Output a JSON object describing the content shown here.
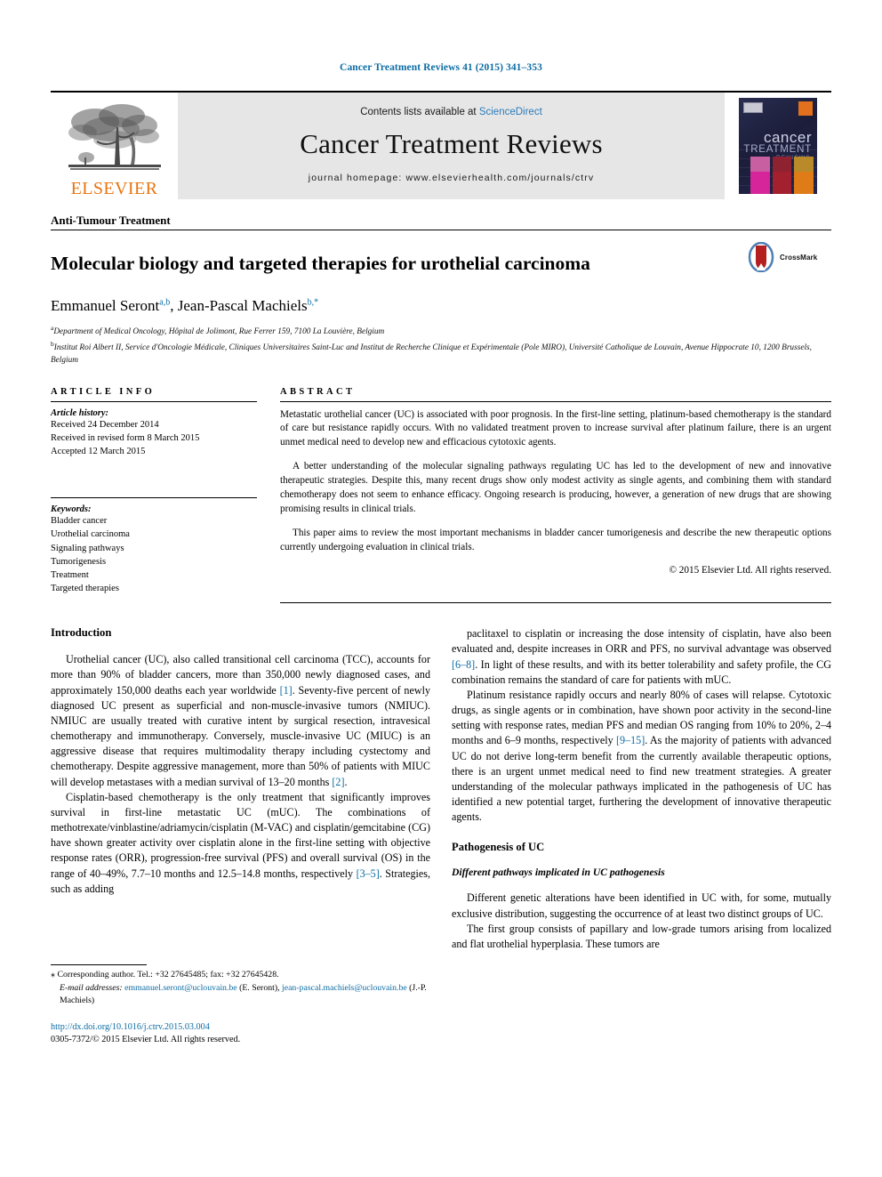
{
  "running_head": "Cancer Treatment Reviews 41 (2015) 341–353",
  "colors": {
    "link_blue": "#0c6ca3",
    "sciencedirect_blue": "#2b7bb9",
    "elsevier_orange": "#e87511",
    "banner_grey": "#e6e6e6",
    "cover_navy": "#23264a"
  },
  "banner": {
    "publisher_logo_text": "ELSEVIER",
    "contents_prefix": "Contents lists available at ",
    "contents_link": "ScienceDirect",
    "journal_name": "Cancer Treatment Reviews",
    "homepage": "journal homepage: www.elsevierhealth.com/journals/ctrv",
    "cover": {
      "line1": "cancer",
      "line2": "TREATMENT",
      "line3": "REVIEWS"
    }
  },
  "article": {
    "kicker": "Anti-Tumour Treatment",
    "title": "Molecular biology and targeted therapies for urothelial carcinoma",
    "crossmark_label": "CrossMark",
    "authors": [
      {
        "name": "Emmanuel Seront",
        "marks": "a,b"
      },
      {
        "name": "Jean-Pascal Machiels",
        "marks": "b,*"
      }
    ],
    "authors_separator": ", ",
    "affiliations": [
      {
        "mark": "a",
        "text": "Department of Medical Oncology, Hôpital de Jolimont, Rue Ferrer 159, 7100 La Louvière, Belgium"
      },
      {
        "mark": "b",
        "text": "Institut Roi Albert II, Service d'Oncologie Médicale, Cliniques Universitaires Saint-Luc and Institut de Recherche Clinique et Expérimentale (Pole MIRO), Université Catholique de Louvain, Avenue Hippocrate 10, 1200 Brussels, Belgium"
      }
    ]
  },
  "article_info": {
    "heading": "ARTICLE INFO",
    "history_label": "Article history:",
    "history": [
      "Received 24 December 2014",
      "Received in revised form 8 March 2015",
      "Accepted 12 March 2015"
    ],
    "keywords_label": "Keywords:",
    "keywords": [
      "Bladder cancer",
      "Urothelial carcinoma",
      "Signaling pathways",
      "Tumorigenesis",
      "Treatment",
      "Targeted therapies"
    ]
  },
  "abstract": {
    "heading": "ABSTRACT",
    "paragraphs": [
      "Metastatic urothelial cancer (UC) is associated with poor prognosis. In the first-line setting, platinum-based chemotherapy is the standard of care but resistance rapidly occurs. With no validated treatment proven to increase survival after platinum failure, there is an urgent unmet medical need to develop new and efficacious cytotoxic agents.",
      "A better understanding of the molecular signaling pathways regulating UC has led to the development of new and innovative therapeutic strategies. Despite this, many recent drugs show only modest activity as single agents, and combining them with standard chemotherapy does not seem to enhance efficacy. Ongoing research is producing, however, a generation of new drugs that are showing promising results in clinical trials.",
      "This paper aims to review the most important mechanisms in bladder cancer tumorigenesis and describe the new therapeutic options currently undergoing evaluation in clinical trials."
    ],
    "copyright": "© 2015 Elsevier Ltd. All rights reserved."
  },
  "body": {
    "left": {
      "heading": "Introduction",
      "paragraphs": [
        [
          {
            "t": "Urothelial cancer (UC), also called transitional cell carcinoma (TCC), accounts for more than 90% of bladder cancers, more than 350,000 newly diagnosed cases, and approximately 150,000 deaths each year worldwide "
          },
          {
            "t": "[1]",
            "ref": true
          },
          {
            "t": ". Seventy-five percent of newly diagnosed UC present as superficial and non-muscle-invasive tumors (NMIUC). NMIUC are usually treated with curative intent by surgical resection, intravesical chemotherapy and immunotherapy. Conversely, muscle-invasive UC (MIUC) is an aggressive disease that requires multimodality therapy including cystectomy and chemotherapy. Despite aggressive management, more than 50% of patients with MIUC will develop metastases with a median survival of 13–20 months "
          },
          {
            "t": "[2]",
            "ref": true
          },
          {
            "t": "."
          }
        ],
        [
          {
            "t": "Cisplatin-based chemotherapy is the only treatment that significantly improves survival in first-line metastatic UC (mUC). The combinations of methotrexate/vinblastine/adriamycin/cisplatin (M-VAC) and cisplatin/gemcitabine (CG) have shown greater activity over cisplatin alone in the first-line setting with objective response rates (ORR), progression-free survival (PFS) and overall survival (OS) in the range of 40–49%, 7.7–10 months and 12.5–14.8 months, respectively "
          },
          {
            "t": "[3–5]",
            "ref": true
          },
          {
            "t": ". Strategies, such as adding"
          }
        ]
      ]
    },
    "right": {
      "paragraphs": [
        [
          {
            "t": "paclitaxel to cisplatin or increasing the dose intensity of cisplatin, have also been evaluated and, despite increases in ORR and PFS, no survival advantage was observed "
          },
          {
            "t": "[6–8]",
            "ref": true
          },
          {
            "t": ". In light of these results, and with its better tolerability and safety profile, the CG combination remains the standard of care for patients with mUC."
          }
        ],
        [
          {
            "t": "Platinum resistance rapidly occurs and nearly 80% of cases will relapse. Cytotoxic drugs, as single agents or in combination, have shown poor activity in the second-line setting with response rates, median PFS and median OS ranging from 10% to 20%, 2–4 months and 6–9 months, respectively "
          },
          {
            "t": "[9–15]",
            "ref": true
          },
          {
            "t": ". As the majority of patients with advanced UC do not derive long-term benefit from the currently available therapeutic options, there is an urgent unmet medical need to find new treatment strategies. A greater understanding of the molecular pathways implicated in the pathogenesis of UC has identified a new potential target, furthering the development of innovative therapeutic agents."
          }
        ]
      ],
      "heading": "Pathogenesis of UC",
      "subheading": "Different pathways implicated in UC pathogenesis",
      "paragraphs2": [
        [
          {
            "t": "Different genetic alterations have been identified in UC with, for some, mutually exclusive distribution, suggesting the occurrence of at least two distinct groups of UC."
          }
        ],
        [
          {
            "t": "The first group consists of papillary and low-grade tumors arising from localized and flat urothelial hyperplasia. These tumors are"
          }
        ]
      ]
    }
  },
  "footnotes": {
    "corresponding": "Corresponding author. Tel.: +32 27645485; fax: +32 27645428.",
    "corresponding_mark": "⁎",
    "email_label": "E-mail addresses:",
    "emails": [
      {
        "address": "emmanuel.seront@uclouvain.be",
        "owner": "(E. Seront)"
      },
      {
        "address": "jean-pascal.machiels@uclouvain.be",
        "owner": "(J.-P. Machiels)"
      }
    ],
    "doi": "http://dx.doi.org/10.1016/j.ctrv.2015.03.004",
    "issn_line": "0305-7372/© 2015 Elsevier Ltd. All rights reserved."
  }
}
